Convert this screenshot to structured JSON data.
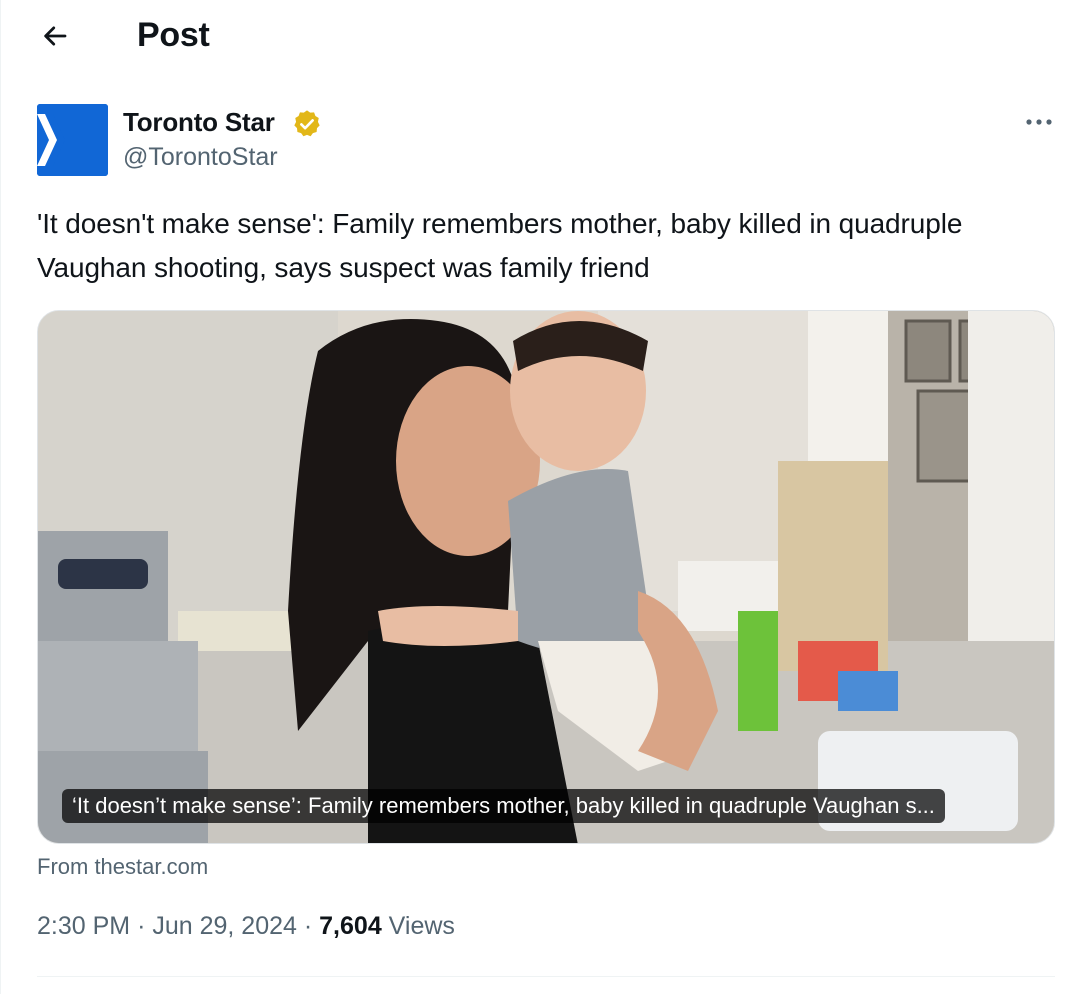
{
  "header": {
    "title": "Post"
  },
  "author": {
    "name": "Toronto Star",
    "handle": "@TorontoStar"
  },
  "tweet": {
    "text": "'It doesn't make sense': Family remembers mother, baby killed in quadruple Vaughan shooting, says suspect was family friend"
  },
  "card": {
    "caption": "‘It doesn’t make sense’: Family remembers mother, baby killed in quadruple Vaughan s...",
    "source": "From thestar.com"
  },
  "meta": {
    "time": "2:30 PM",
    "separator": "·",
    "date": "Jun 29, 2024",
    "views_count": "7,604",
    "views_label": "Views"
  },
  "colors": {
    "brand_blue": "#1167d6",
    "verified_gold": "#e2b719",
    "secondary_text": "#536471"
  }
}
